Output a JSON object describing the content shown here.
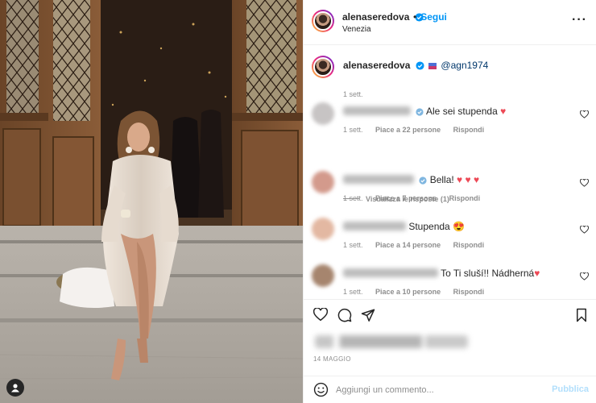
{
  "post": {
    "author": "alenaseredova",
    "follow_label": "Segui",
    "follow_dot": "•",
    "location": "Venezia",
    "more_label": "···"
  },
  "caption": {
    "author": "alenaseredova",
    "mention": "@agn1974",
    "time": "1 sett."
  },
  "comments": [
    {
      "text": "Ale sei stupenda ",
      "emoji": "♥",
      "time": "1 sett.",
      "likes": "Piace a 22 persone",
      "reply": "Rispondi",
      "avatar_color": "#c7c4c4"
    },
    {
      "text": "Bella! ",
      "emoji": "♥ ♥ ♥",
      "time": "1 sett.",
      "likes": "Piace a 7 persone",
      "reply": "Rispondi",
      "avatar_color": "#d39a8c"
    },
    {
      "text": "Stupenda ",
      "emoji": "😍",
      "time": "1 sett.",
      "likes": "Piace a 14 persone",
      "reply": "Rispondi",
      "avatar_color": "#e3b8a2"
    },
    {
      "text": "To Ti sluší!! Nádherná",
      "emoji": "♥",
      "time": "1 sett.",
      "likes": "Piace a 10 persone",
      "reply": "Rispondi",
      "avatar_color": "#a6856e"
    }
  ],
  "view_replies": "Visualizza le risposte (1)",
  "date": "14 MAGGIO",
  "add_comment": {
    "placeholder": "Aggiungi un commento...",
    "publish_label": "Pubblica"
  },
  "colors": {
    "accent": "#0095f6",
    "like_red": "#ed4956",
    "muted": "#8e8e8e",
    "text": "#262626"
  },
  "icons": [
    "verified-badge-icon",
    "more-options-icon",
    "heart-icon",
    "comment-icon",
    "share-icon",
    "bookmark-icon",
    "emoji-icon",
    "user-tag-icon"
  ]
}
